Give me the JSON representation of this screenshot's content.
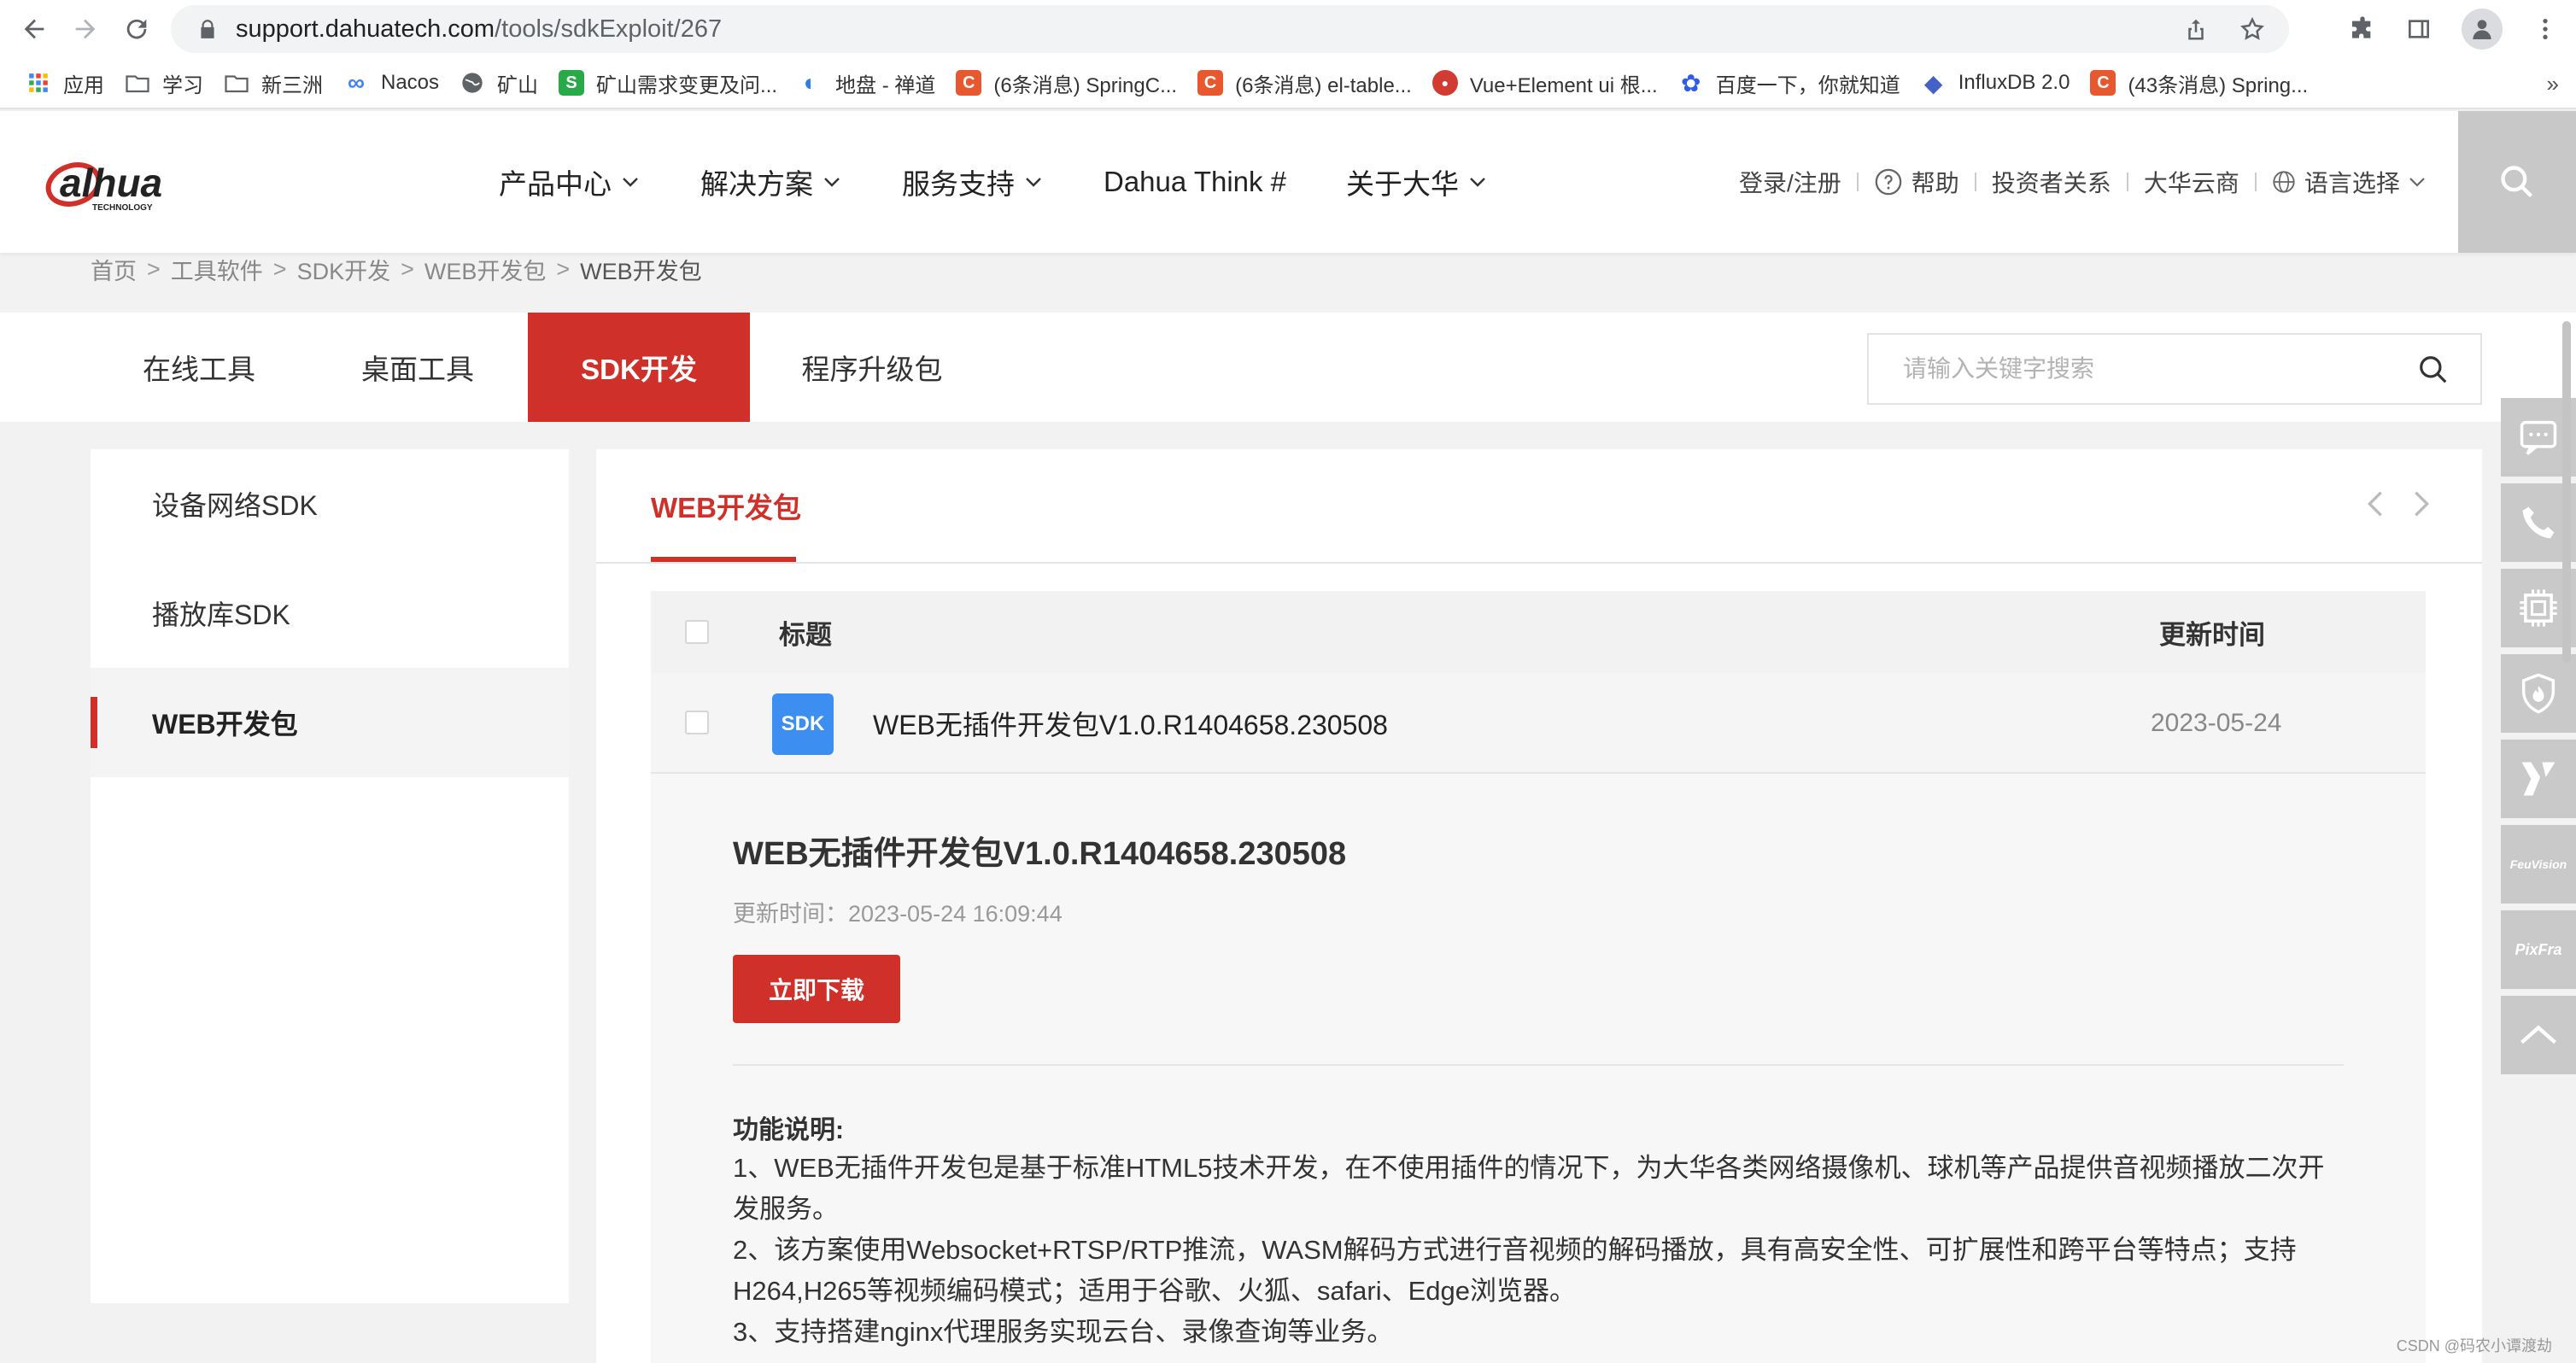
{
  "browser": {
    "url_host": "support.dahuatech.com",
    "url_path": "/tools/sdkExploit/267",
    "bookmarks": [
      {
        "label": "应用",
        "icon": "apps-grid-icon",
        "color": "#4285f4"
      },
      {
        "label": "学习",
        "icon": "folder-icon",
        "color": "#5f6368"
      },
      {
        "label": "新三洲",
        "icon": "folder-icon",
        "color": "#5f6368"
      },
      {
        "label": "Nacos",
        "icon": "nacos-icon",
        "color": "#3b82f6"
      },
      {
        "label": "矿山",
        "icon": "globe-icon",
        "color": "#5f6368"
      },
      {
        "label": "矿山需求变更及问...",
        "icon": "s-icon",
        "color": "#2aa94a"
      },
      {
        "label": "地盘 - 禅道",
        "icon": "chandao-icon",
        "color": "#2f7ee6"
      },
      {
        "label": "(6条消息) SpringC...",
        "icon": "csdn-icon",
        "color": "#e8582e"
      },
      {
        "label": "(6条消息) el-table...",
        "icon": "csdn-icon",
        "color": "#e8582e"
      },
      {
        "label": "Vue+Element ui 根...",
        "icon": "drop-icon",
        "color": "#d13b31"
      },
      {
        "label": "百度一下，你就知道",
        "icon": "baidu-icon",
        "color": "#2f5bea"
      },
      {
        "label": "InfluxDB 2.0",
        "icon": "influx-icon",
        "color": "#4461c5"
      },
      {
        "label": "(43条消息) Spring...",
        "icon": "csdn-icon",
        "color": "#e8582e"
      }
    ],
    "bookmarks_more": "»"
  },
  "header": {
    "brand": "alhua",
    "brand_sub": "TECHNOLOGY",
    "nav": [
      "产品中心",
      "解决方案",
      "服务支持",
      "Dahua Think #",
      "关于大华"
    ],
    "links": {
      "login": "登录/注册",
      "help": "帮助",
      "investor": "投资者关系",
      "cloud": "大华云商",
      "language": "语言选择"
    }
  },
  "breadcrumb": [
    "首页",
    "工具软件",
    "SDK开发",
    "WEB开发包",
    "WEB开发包"
  ],
  "tabs": [
    "在线工具",
    "桌面工具",
    "SDK开发",
    "程序升级包"
  ],
  "search": {
    "placeholder": "请输入关键字搜索"
  },
  "sidebar": {
    "items": [
      "设备网络SDK",
      "播放库SDK",
      "WEB开发包"
    ],
    "active_index": 2
  },
  "panel": {
    "tab": "WEB开发包",
    "table": {
      "headers": {
        "title": "标题",
        "time": "更新时间"
      },
      "rows": [
        {
          "badge": "SDK",
          "title": "WEB无插件开发包V1.0.R1404658.230508",
          "date": "2023-05-24"
        }
      ]
    },
    "detail": {
      "title": "WEB无插件开发包V1.0.R1404658.230508",
      "time_label": "更新时间：",
      "time_value": "2023-05-24 16:09:44",
      "download": "立即下载",
      "desc_title": "功能说明:",
      "desc_lines": [
        "1、WEB无插件开发包是基于标准HTML5技术开发，在不使用插件的情况下，为大华各类网络摄像机、球机等产品提供音视频播放二次开发服务。",
        "2、该方案使用Websocket+RTSP/RTP推流，WASM解码方式进行音视频的解码播放，具有高安全性、可扩展性和跨平台等特点；支持H264,H265等视频编码模式；适用于谷歌、火狐、safari、Edge浏览器。",
        "3、支持搭建nginx代理服务实现云台、录像查询等业务。"
      ]
    }
  },
  "float_bar": {
    "items": [
      {
        "icon": "chat-icon"
      },
      {
        "icon": "phone-icon"
      },
      {
        "icon": "chip-icon"
      },
      {
        "icon": "fire-shield-icon"
      },
      {
        "icon": "y-logo-icon"
      },
      {
        "icon": "brand-icon",
        "text": "FeuVision"
      },
      {
        "icon": "brand-icon",
        "text": "PixFra"
      },
      {
        "icon": "back-to-top-icon"
      }
    ]
  },
  "watermark": "CSDN @码农小谭渡劫",
  "colors": {
    "accent": "#d0302a",
    "sdk_badge": "#3c8ff0",
    "float_gray": "#c9c9c9"
  }
}
